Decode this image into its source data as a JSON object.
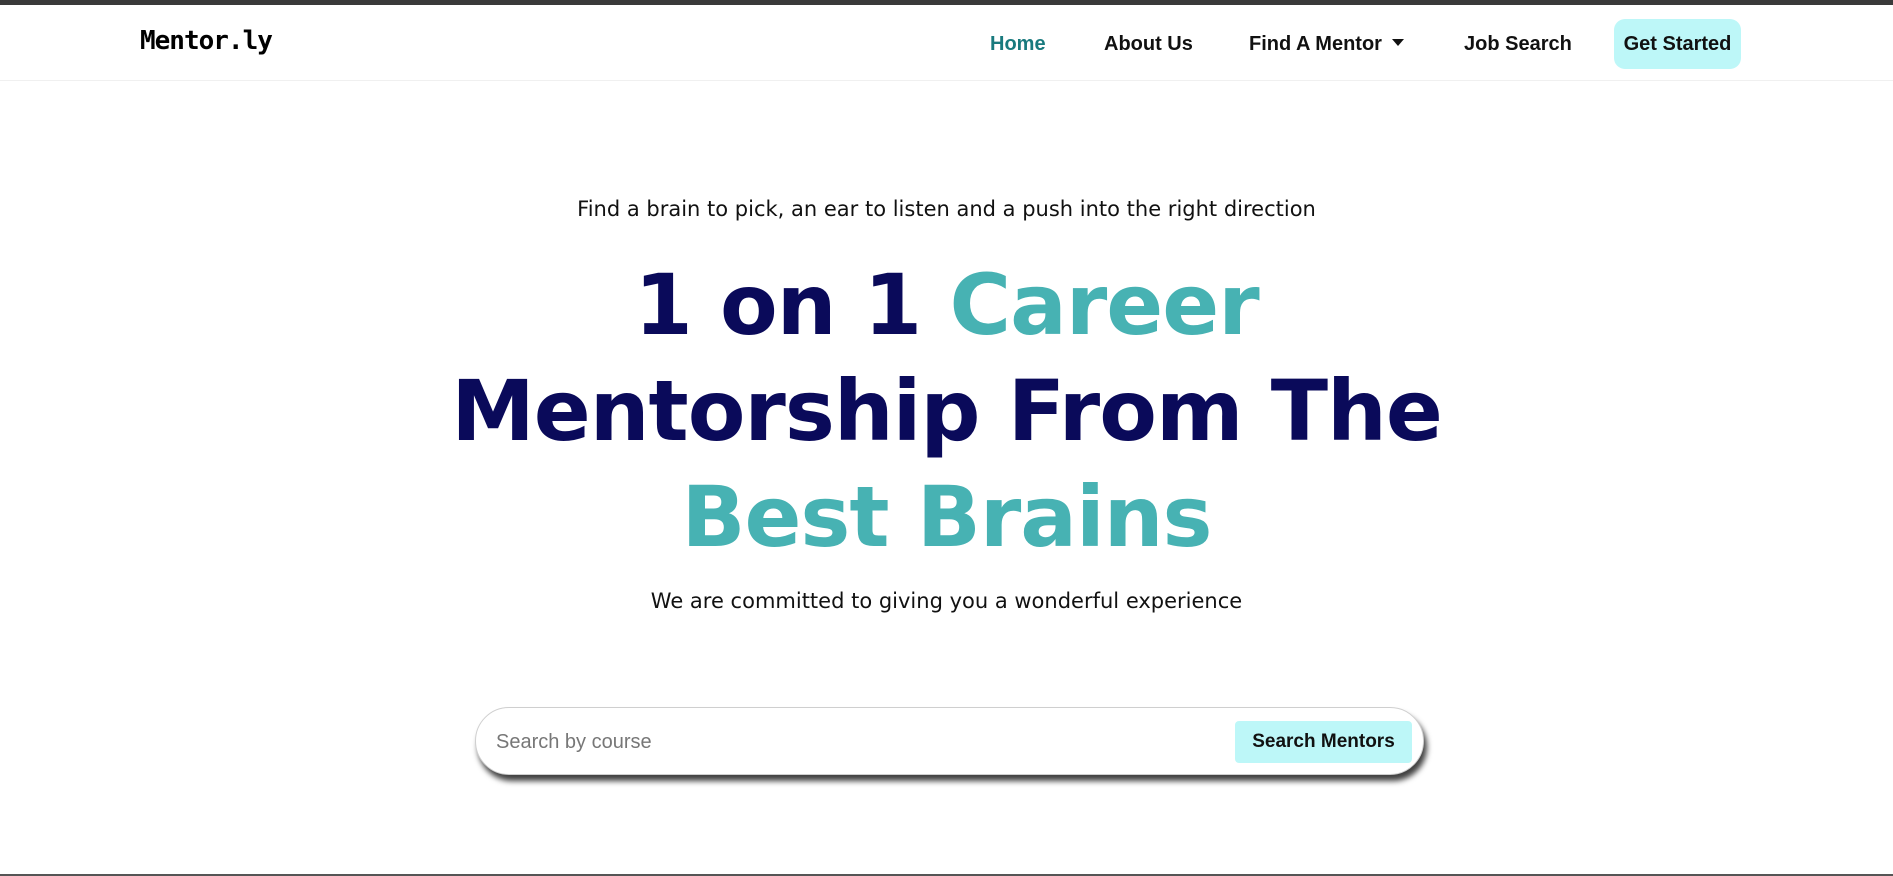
{
  "navbar": {
    "brand": "Mentor.ly",
    "links": [
      {
        "label": "Home",
        "active": true
      },
      {
        "label": "About Us"
      },
      {
        "label": "Find A Mentor",
        "has_dropdown": true
      },
      {
        "label": "Job Search"
      }
    ],
    "cta_label": "Get Started"
  },
  "hero": {
    "tagline": "Find a brain to pick, an ear to listen and a push into the right direction",
    "title_parts": [
      "1 on 1",
      "Career",
      "Mentorship From The",
      "Best Brains"
    ],
    "subtitle": "We are committed to giving you a wonderful experience"
  },
  "search": {
    "placeholder": "Search by course",
    "value": "",
    "button_label": "Search Mentors"
  },
  "colors": {
    "heading_dark": "#0a0a5a",
    "accent_teal": "#47b2b3",
    "active_link": "#197a7e",
    "button_bg": "#bdf7f8"
  }
}
